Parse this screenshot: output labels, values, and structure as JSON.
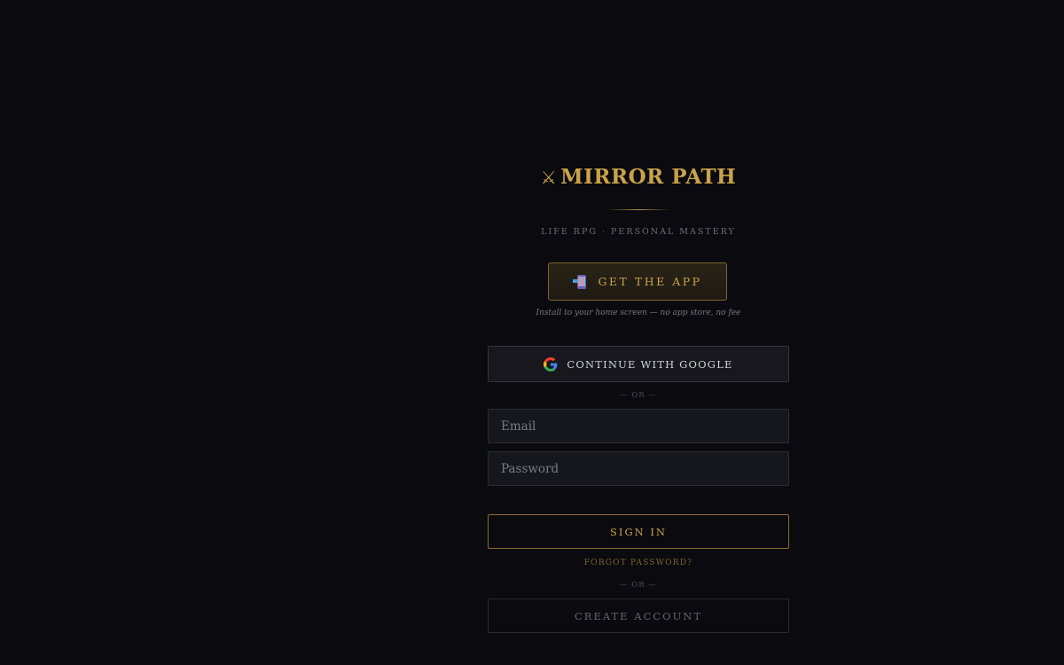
{
  "brand": {
    "icon": "crossed-swords-icon",
    "icon_glyph": "⚔",
    "name": "Mirror Path",
    "name_display": "MIRROR PATH",
    "tagline": "LIFE RPG · PERSONAL MASTERY"
  },
  "get_app": {
    "icon": "install-phone-icon",
    "label": "GET THE APP",
    "note": "Install to your home screen — no app store, no fee"
  },
  "google": {
    "icon": "google-logo-icon",
    "label": "CONTINUE WITH GOOGLE"
  },
  "separators": {
    "or_label": "— OR —"
  },
  "form": {
    "email": {
      "value": "",
      "placeholder": "Email"
    },
    "password": {
      "value": "",
      "placeholder": "Password"
    },
    "sign_in_label": "SIGN IN",
    "forgot_label": "FORGOT PASSWORD?",
    "create_label": "CREATE ACCOUNT"
  },
  "colors": {
    "background": "#0a0a0f",
    "accent_gold": "#c9a24a",
    "muted_text": "#6e6e78",
    "field_bg": "#16171d"
  }
}
